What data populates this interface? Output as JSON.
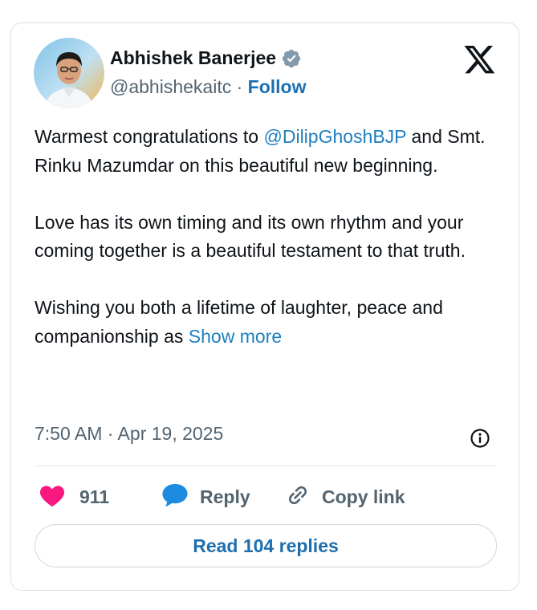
{
  "author": {
    "name": "Abhishek Banerjee",
    "handle": "@abhishekaitc",
    "separator": "·",
    "follow_label": "Follow",
    "verified_icon": "verified-badge-icon"
  },
  "tweet": {
    "paragraph1": {
      "before": "Warmest congratulations to ",
      "mention": "@DilipGhoshBJP",
      "after": " and Smt. Rinku Mazumdar on this beautiful new beginning."
    },
    "paragraph2": "Love has its own timing and its own rhythm and your coming together is a beautiful testament to that truth.",
    "paragraph3": {
      "text": "Wishing you both a lifetime of laughter, peace and  companionship as ",
      "show_more": "Show more"
    }
  },
  "timestamp": "7:50 AM · Apr 19, 2025",
  "actions": {
    "like_count": "911",
    "reply_label": "Reply",
    "copy_link_label": "Copy link"
  },
  "read_replies_label": "Read 104 replies",
  "colors": {
    "accent": "#1d6fb0",
    "link": "#1d7fc0",
    "like": "#f91880",
    "secondary_text": "#536471"
  }
}
